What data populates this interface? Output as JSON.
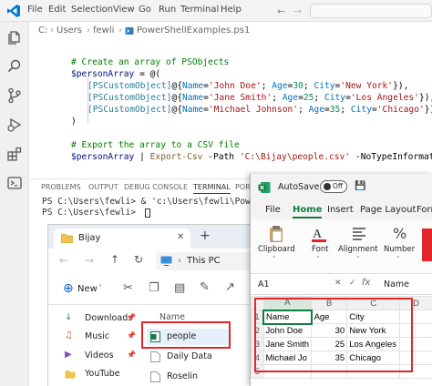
{
  "vscode": {
    "menu": [
      "File",
      "Edit",
      "Selection",
      "View",
      "Go",
      "Run",
      "Terminal",
      "Help"
    ],
    "breadcrumb": [
      "C:",
      "Users",
      "fewli",
      "PowerShellExamples.ps1"
    ],
    "code": {
      "comment1": "# Create an array of PSObjects",
      "var": "$personArray",
      "assign": " = @(",
      "rows": [
        {
          "name": "'John Doe'",
          "age": "30",
          "city": "'New York'",
          "sep": "),"
        },
        {
          "name": "'Jane Smith'",
          "age": "25",
          "city": "'Los Angeles'",
          "sep": "),"
        },
        {
          "name": "'Michael Johnson'",
          "age": "35",
          "city": "'Chicago'",
          "sep": ")"
        }
      ],
      "type": "[PSCustomObject]",
      "at": "@{",
      "k_name": "Name",
      "k_age": "Age",
      "k_city": "City",
      "close": ")",
      "comment2": "# Export the array to a CSV file",
      "pipe": " | ",
      "cmd": "Export-Csv",
      "path_flag": " -Path ",
      "path": "'C:\\Bijay\\people.csv'",
      "notype": " -NoTypeInformation"
    },
    "panel_tabs": [
      "PROBLEMS",
      "OUTPUT",
      "DEBUG CONSOLE",
      "TERMINAL",
      "PORTS"
    ],
    "terminal": [
      "PS C:\\Users\\fewli> & 'c:\\Users\\fewli\\PowerShellE",
      "PS C:\\Users\\fewli> "
    ]
  },
  "explorer": {
    "tab_title": "Bijay",
    "address": "This PC",
    "new_label": "New",
    "column_name": "Name",
    "quick_access": [
      "Downloads",
      "Music",
      "Videos",
      "YouTube"
    ],
    "files": [
      "people",
      "Daily Data",
      "Roselin"
    ]
  },
  "excel": {
    "autosave": "AutoSave",
    "autosave_state": "Off",
    "tabs": [
      "File",
      "Home",
      "Insert",
      "Page Layout",
      "Form"
    ],
    "active_tab": "Home",
    "ribbon": [
      "Clipboard",
      "Font",
      "Alignment",
      "Number"
    ],
    "name_box": "A1",
    "formula": "Name",
    "columns": [
      "A",
      "B",
      "C",
      "D"
    ],
    "rows": [
      {
        "n": "1",
        "a": "Name",
        "b": "Age",
        "c": "City"
      },
      {
        "n": "2",
        "a": "John Doe",
        "b": "30",
        "c": "New York"
      },
      {
        "n": "3",
        "a": "Jane Smith",
        "b": "25",
        "c": "Los Angeles"
      },
      {
        "n": "4",
        "a": "Michael Jo",
        "b": "35",
        "c": "Chicago"
      },
      {
        "n": "5",
        "a": "",
        "b": "",
        "c": ""
      }
    ],
    "accent": "#107c41"
  },
  "highlight_color": "#e2262c"
}
